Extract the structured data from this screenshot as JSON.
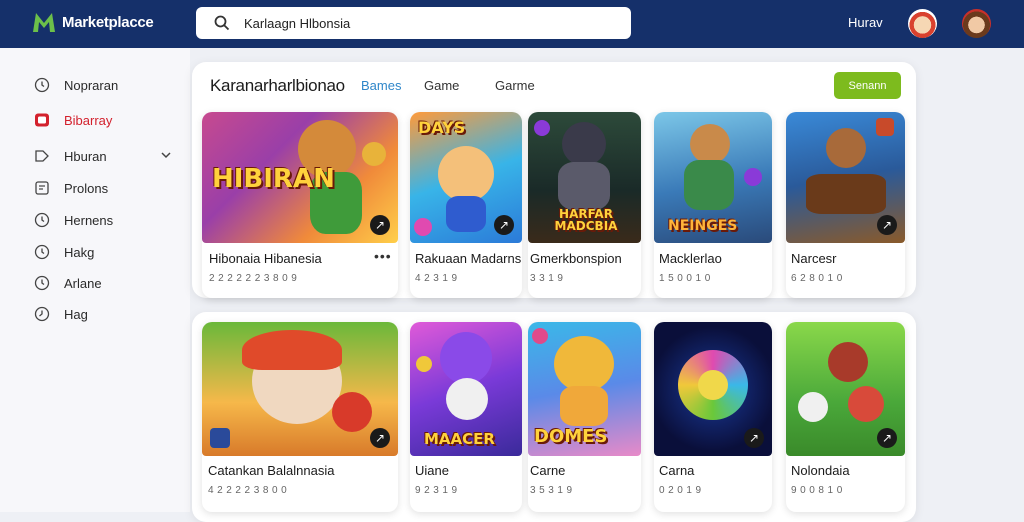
{
  "header": {
    "logo_text": "Marketplacce",
    "search_value": "Karlaagn Hlbonsia",
    "top_link": "Hurav"
  },
  "sidebar": {
    "items": [
      {
        "label": "Nopraran",
        "icon": "clock-icon"
      },
      {
        "label": "Bibarray",
        "icon": "tv-icon",
        "active": true
      },
      {
        "label": "Hburan",
        "icon": "tag-icon"
      },
      {
        "label": "Prolons",
        "icon": "document-icon"
      },
      {
        "label": "Hernens",
        "icon": "clock-icon"
      },
      {
        "label": "Hakg",
        "icon": "clock-icon"
      },
      {
        "label": "Arlane",
        "icon": "clock-icon"
      },
      {
        "label": "Hag",
        "icon": "clock-icon"
      }
    ]
  },
  "main": {
    "section_title": "Karanarharlbionao",
    "tabs": [
      "Bames",
      "Game",
      "Garme"
    ],
    "action_button": "Senann",
    "row1": [
      {
        "thumb_text": "HIBIRAN",
        "title": "Hibonaia Hibanesia",
        "sub": "2 2 2 2 2 2  3 8 0 9",
        "badge": "↗"
      },
      {
        "thumb_text": "DAYS",
        "title": "Rakuaan Madarns",
        "sub": "4 2 3 1 9",
        "badge": "↗"
      },
      {
        "thumb_text": "HARFAR MADCBIA",
        "title": "Gmerkbonspion",
        "sub": "3 3 1 9",
        "badge": ""
      },
      {
        "thumb_text": "NEINGES",
        "title": "Macklerlao",
        "sub": "1 5 0 0 1 0",
        "badge": ""
      },
      {
        "thumb_text": "",
        "title": "Narcesr",
        "sub": "6 2 8 0 1 0",
        "badge": "↗"
      }
    ],
    "row2": [
      {
        "thumb_text": "",
        "title": "Catankan Balalnnasia",
        "sub": "4 2 2 2 2  3 8 0 0",
        "badge": "↗"
      },
      {
        "thumb_text": "MAACER",
        "title": "Uiane",
        "sub": "9 2 3 1 9",
        "badge": ""
      },
      {
        "thumb_text": "DOMES",
        "title": "Carne",
        "sub": "3 5 3 1 9",
        "badge": ""
      },
      {
        "thumb_text": "",
        "title": "Carna",
        "sub": "0 2 0 1 9",
        "badge": "↗"
      },
      {
        "thumb_text": "",
        "title": "Nolondaia",
        "sub": "9 0 0 8 1 0",
        "badge": "↗"
      }
    ]
  },
  "colors": {
    "header_bg": "#15306a",
    "accent_green": "#7dbb1e",
    "active_red": "#d3212d",
    "tab_blue": "#2f86c9"
  }
}
